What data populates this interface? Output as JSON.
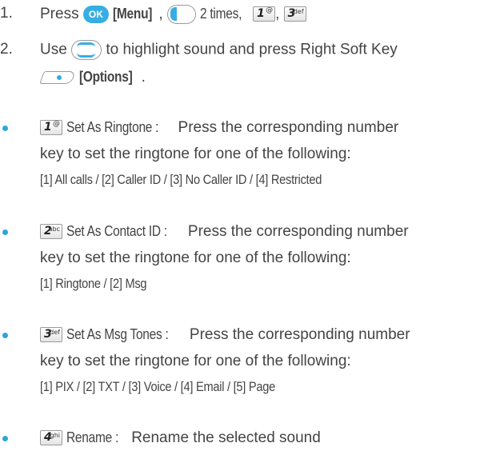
{
  "steps": [
    {
      "num": "1.",
      "press": "Press",
      "ok_label": "OK",
      "menu": "[Menu]",
      "sep1": ",",
      "times": "2 times,",
      "sep2": ",",
      "key1": {
        "num": "1",
        "letters": "@"
      },
      "key3": {
        "num": "3",
        "letters": "def"
      }
    },
    {
      "num": "2.",
      "text_a": "Use",
      "text_b": "to highlight sound and press Right Soft Key",
      "options": "[Options]",
      "period": "."
    }
  ],
  "bullets": [
    {
      "key": {
        "num": "1",
        "letters": "@"
      },
      "title": "Set As Ringtone :",
      "desc1": " Press the corresponding number",
      "desc2": "key to set the ringtone for one of the following:",
      "desc3": "[1] All calls / [2] Caller ID / [3] No Caller ID / [4] Restricted"
    },
    {
      "key": {
        "num": "2",
        "letters": "abc"
      },
      "title": "Set As Contact ID :",
      "desc1": " Press the corresponding number",
      "desc2": "key to set the ringtone for one of the following:",
      "desc3": "[1] Ringtone / [2] Msg"
    },
    {
      "key": {
        "num": "3",
        "letters": "def"
      },
      "title": "Set As Msg Tones :",
      "desc1": " Press the corresponding number",
      "desc2": "key to set the ringtone for one of the following:",
      "desc3": "[1] PIX / [2] TXT / [3] Voice / [4] Email / [5] Page"
    },
    {
      "key": {
        "num": "4",
        "letters": "ghi"
      },
      "title": "Rename :",
      "desc1": " Rename the selected sound"
    }
  ],
  "colors": {
    "accent": "#36aee3",
    "bullet": "#2ba6d8",
    "text": "#444444"
  }
}
